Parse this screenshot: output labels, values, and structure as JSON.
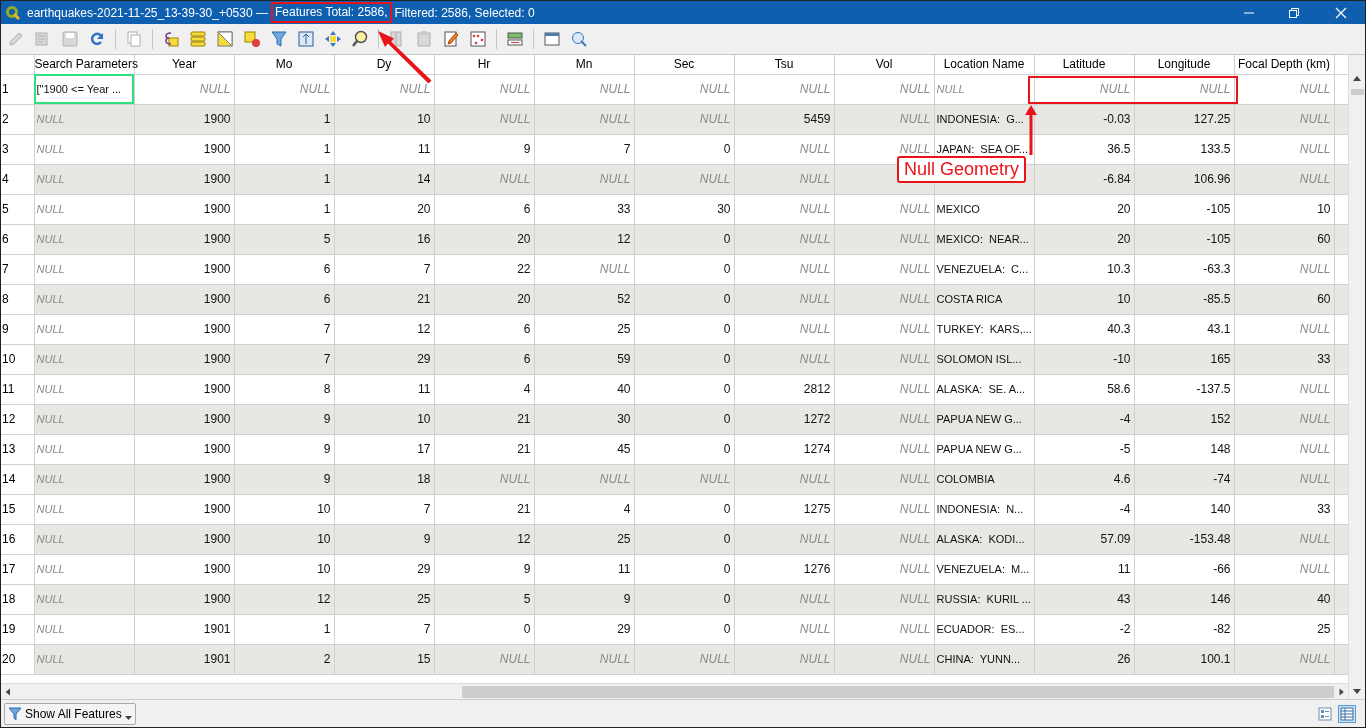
{
  "window": {
    "title_parts": [
      {
        "text": "earthquakes-2021-11-25_13-39-30_+0530 —",
        "highlighted": false
      },
      {
        "text": "Features Total: 2586,",
        "highlighted": true
      },
      {
        "text": "Filtered: 2586, Selected: 0",
        "highlighted": false
      }
    ]
  },
  "toolbar": [
    {
      "kind": "pencil",
      "disabled": true
    },
    {
      "kind": "multi-edit",
      "disabled": true
    },
    {
      "kind": "save",
      "disabled": true
    },
    {
      "kind": "refresh",
      "disabled": false
    },
    {
      "kind": "sep"
    },
    {
      "kind": "copy",
      "disabled": true
    },
    {
      "kind": "sep"
    },
    {
      "kind": "expression",
      "disabled": false
    },
    {
      "kind": "select-all",
      "disabled": false
    },
    {
      "kind": "invert",
      "disabled": false
    },
    {
      "kind": "deselect",
      "disabled": false
    },
    {
      "kind": "filter",
      "disabled": false
    },
    {
      "kind": "move-top",
      "disabled": false
    },
    {
      "kind": "pan",
      "disabled": false
    },
    {
      "kind": "zoom",
      "disabled": false
    },
    {
      "kind": "sep"
    },
    {
      "kind": "delete-field",
      "disabled": true
    },
    {
      "kind": "paste",
      "disabled": true
    },
    {
      "kind": "field-calc",
      "disabled": false
    },
    {
      "kind": "abacus",
      "disabled": false
    },
    {
      "kind": "sep"
    },
    {
      "kind": "conditional",
      "disabled": false
    },
    {
      "kind": "sep"
    },
    {
      "kind": "dock",
      "disabled": false
    },
    {
      "kind": "actions",
      "disabled": false
    }
  ],
  "table": {
    "columns": [
      {
        "label": "Search Parameters",
        "kind": "text"
      },
      {
        "label": "Year",
        "kind": "number"
      },
      {
        "label": "Mo",
        "kind": "number"
      },
      {
        "label": "Dy",
        "kind": "number"
      },
      {
        "label": "Hr",
        "kind": "number"
      },
      {
        "label": "Mn",
        "kind": "number"
      },
      {
        "label": "Sec",
        "kind": "number"
      },
      {
        "label": "Tsu",
        "kind": "number"
      },
      {
        "label": "Vol",
        "kind": "number"
      },
      {
        "label": "Location Name",
        "kind": "text"
      },
      {
        "label": "Latitude",
        "kind": "number"
      },
      {
        "label": "Longitude",
        "kind": "number"
      },
      {
        "label": "Focal Depth (km)",
        "kind": "number"
      }
    ],
    "rows": [
      {
        "num": "1",
        "focused": true,
        "cells": [
          {
            "v": "[\"1900 <= Year ...",
            "null": false
          },
          {
            "v": "NULL",
            "null": true
          },
          {
            "v": "NULL",
            "null": true
          },
          {
            "v": "NULL",
            "null": true
          },
          {
            "v": "NULL",
            "null": true
          },
          {
            "v": "NULL",
            "null": true
          },
          {
            "v": "NULL",
            "null": true
          },
          {
            "v": "NULL",
            "null": true
          },
          {
            "v": "NULL",
            "null": true
          },
          {
            "v": "NULL",
            "null": true
          },
          {
            "v": "NULL",
            "null": true
          },
          {
            "v": "NULL",
            "null": true
          },
          {
            "v": "NULL",
            "null": true
          }
        ]
      },
      {
        "num": "2",
        "focused": false,
        "cells": [
          {
            "v": "NULL",
            "null": true
          },
          {
            "v": "1900",
            "null": false
          },
          {
            "v": "1",
            "null": false
          },
          {
            "v": "10",
            "null": false
          },
          {
            "v": "NULL",
            "null": true
          },
          {
            "v": "NULL",
            "null": true
          },
          {
            "v": "NULL",
            "null": true
          },
          {
            "v": "5459",
            "null": false
          },
          {
            "v": "NULL",
            "null": true
          },
          {
            "v": "INDONESIA:  G...",
            "null": false
          },
          {
            "v": "-0.03",
            "null": false
          },
          {
            "v": "127.25",
            "null": false
          },
          {
            "v": "NULL",
            "null": true
          }
        ]
      },
      {
        "num": "3",
        "focused": false,
        "cells": [
          {
            "v": "NULL",
            "null": true
          },
          {
            "v": "1900",
            "null": false
          },
          {
            "v": "1",
            "null": false
          },
          {
            "v": "11",
            "null": false
          },
          {
            "v": "9",
            "null": false
          },
          {
            "v": "7",
            "null": false
          },
          {
            "v": "0",
            "null": false
          },
          {
            "v": "NULL",
            "null": true
          },
          {
            "v": "NULL",
            "null": true
          },
          {
            "v": "JAPAN:  SEA OF...",
            "null": false
          },
          {
            "v": "36.5",
            "null": false
          },
          {
            "v": "133.5",
            "null": false
          },
          {
            "v": "NULL",
            "null": true
          }
        ]
      },
      {
        "num": "4",
        "focused": false,
        "cells": [
          {
            "v": "NULL",
            "null": true
          },
          {
            "v": "1900",
            "null": false
          },
          {
            "v": "1",
            "null": false
          },
          {
            "v": "14",
            "null": false
          },
          {
            "v": "NULL",
            "null": true
          },
          {
            "v": "NULL",
            "null": true
          },
          {
            "v": "NULL",
            "null": true
          },
          {
            "v": "NULL",
            "null": true
          },
          null,
          null,
          {
            "v": "-6.84",
            "null": false
          },
          {
            "v": "106.96",
            "null": false
          },
          {
            "v": "NULL",
            "null": true
          }
        ]
      },
      {
        "num": "5",
        "focused": false,
        "cells": [
          {
            "v": "NULL",
            "null": true
          },
          {
            "v": "1900",
            "null": false
          },
          {
            "v": "1",
            "null": false
          },
          {
            "v": "20",
            "null": false
          },
          {
            "v": "6",
            "null": false
          },
          {
            "v": "33",
            "null": false
          },
          {
            "v": "30",
            "null": false
          },
          {
            "v": "NULL",
            "null": true
          },
          {
            "v": "NULL",
            "null": true
          },
          {
            "v": "MEXICO",
            "null": false
          },
          {
            "v": "20",
            "null": false
          },
          {
            "v": "-105",
            "null": false
          },
          {
            "v": "10",
            "null": false
          }
        ]
      },
      {
        "num": "6",
        "focused": false,
        "cells": [
          {
            "v": "NULL",
            "null": true
          },
          {
            "v": "1900",
            "null": false
          },
          {
            "v": "5",
            "null": false
          },
          {
            "v": "16",
            "null": false
          },
          {
            "v": "20",
            "null": false
          },
          {
            "v": "12",
            "null": false
          },
          {
            "v": "0",
            "null": false
          },
          {
            "v": "NULL",
            "null": true
          },
          {
            "v": "NULL",
            "null": true
          },
          {
            "v": "MEXICO:  NEAR...",
            "null": false
          },
          {
            "v": "20",
            "null": false
          },
          {
            "v": "-105",
            "null": false
          },
          {
            "v": "60",
            "null": false
          }
        ]
      },
      {
        "num": "7",
        "focused": false,
        "cells": [
          {
            "v": "NULL",
            "null": true
          },
          {
            "v": "1900",
            "null": false
          },
          {
            "v": "6",
            "null": false
          },
          {
            "v": "7",
            "null": false
          },
          {
            "v": "22",
            "null": false
          },
          {
            "v": "NULL",
            "null": true
          },
          {
            "v": "0",
            "null": false
          },
          {
            "v": "NULL",
            "null": true
          },
          {
            "v": "NULL",
            "null": true
          },
          {
            "v": "VENEZUELA:  C...",
            "null": false
          },
          {
            "v": "10.3",
            "null": false
          },
          {
            "v": "-63.3",
            "null": false
          },
          {
            "v": "NULL",
            "null": true
          }
        ]
      },
      {
        "num": "8",
        "focused": false,
        "cells": [
          {
            "v": "NULL",
            "null": true
          },
          {
            "v": "1900",
            "null": false
          },
          {
            "v": "6",
            "null": false
          },
          {
            "v": "21",
            "null": false
          },
          {
            "v": "20",
            "null": false
          },
          {
            "v": "52",
            "null": false
          },
          {
            "v": "0",
            "null": false
          },
          {
            "v": "NULL",
            "null": true
          },
          {
            "v": "NULL",
            "null": true
          },
          {
            "v": "COSTA RICA",
            "null": false
          },
          {
            "v": "10",
            "null": false
          },
          {
            "v": "-85.5",
            "null": false
          },
          {
            "v": "60",
            "null": false
          }
        ]
      },
      {
        "num": "9",
        "focused": false,
        "cells": [
          {
            "v": "NULL",
            "null": true
          },
          {
            "v": "1900",
            "null": false
          },
          {
            "v": "7",
            "null": false
          },
          {
            "v": "12",
            "null": false
          },
          {
            "v": "6",
            "null": false
          },
          {
            "v": "25",
            "null": false
          },
          {
            "v": "0",
            "null": false
          },
          {
            "v": "NULL",
            "null": true
          },
          {
            "v": "NULL",
            "null": true
          },
          {
            "v": "TURKEY:  KARS,...",
            "null": false
          },
          {
            "v": "40.3",
            "null": false
          },
          {
            "v": "43.1",
            "null": false
          },
          {
            "v": "NULL",
            "null": true
          }
        ]
      },
      {
        "num": "10",
        "focused": false,
        "cells": [
          {
            "v": "NULL",
            "null": true
          },
          {
            "v": "1900",
            "null": false
          },
          {
            "v": "7",
            "null": false
          },
          {
            "v": "29",
            "null": false
          },
          {
            "v": "6",
            "null": false
          },
          {
            "v": "59",
            "null": false
          },
          {
            "v": "0",
            "null": false
          },
          {
            "v": "NULL",
            "null": true
          },
          {
            "v": "NULL",
            "null": true
          },
          {
            "v": "SOLOMON ISL...",
            "null": false
          },
          {
            "v": "-10",
            "null": false
          },
          {
            "v": "165",
            "null": false
          },
          {
            "v": "33",
            "null": false
          }
        ]
      },
      {
        "num": "11",
        "focused": false,
        "cells": [
          {
            "v": "NULL",
            "null": true
          },
          {
            "v": "1900",
            "null": false
          },
          {
            "v": "8",
            "null": false
          },
          {
            "v": "11",
            "null": false
          },
          {
            "v": "4",
            "null": false
          },
          {
            "v": "40",
            "null": false
          },
          {
            "v": "0",
            "null": false
          },
          {
            "v": "2812",
            "null": false
          },
          {
            "v": "NULL",
            "null": true
          },
          {
            "v": "ALASKA:  SE. A...",
            "null": false
          },
          {
            "v": "58.6",
            "null": false
          },
          {
            "v": "-137.5",
            "null": false
          },
          {
            "v": "NULL",
            "null": true
          }
        ]
      },
      {
        "num": "12",
        "focused": false,
        "cells": [
          {
            "v": "NULL",
            "null": true
          },
          {
            "v": "1900",
            "null": false
          },
          {
            "v": "9",
            "null": false
          },
          {
            "v": "10",
            "null": false
          },
          {
            "v": "21",
            "null": false
          },
          {
            "v": "30",
            "null": false
          },
          {
            "v": "0",
            "null": false
          },
          {
            "v": "1272",
            "null": false
          },
          {
            "v": "NULL",
            "null": true
          },
          {
            "v": "PAPUA NEW G...",
            "null": false
          },
          {
            "v": "-4",
            "null": false
          },
          {
            "v": "152",
            "null": false
          },
          {
            "v": "NULL",
            "null": true
          }
        ]
      },
      {
        "num": "13",
        "focused": false,
        "cells": [
          {
            "v": "NULL",
            "null": true
          },
          {
            "v": "1900",
            "null": false
          },
          {
            "v": "9",
            "null": false
          },
          {
            "v": "17",
            "null": false
          },
          {
            "v": "21",
            "null": false
          },
          {
            "v": "45",
            "null": false
          },
          {
            "v": "0",
            "null": false
          },
          {
            "v": "1274",
            "null": false
          },
          {
            "v": "NULL",
            "null": true
          },
          {
            "v": "PAPUA NEW G...",
            "null": false
          },
          {
            "v": "-5",
            "null": false
          },
          {
            "v": "148",
            "null": false
          },
          {
            "v": "NULL",
            "null": true
          }
        ]
      },
      {
        "num": "14",
        "focused": false,
        "cells": [
          {
            "v": "NULL",
            "null": true
          },
          {
            "v": "1900",
            "null": false
          },
          {
            "v": "9",
            "null": false
          },
          {
            "v": "18",
            "null": false
          },
          {
            "v": "NULL",
            "null": true
          },
          {
            "v": "NULL",
            "null": true
          },
          {
            "v": "NULL",
            "null": true
          },
          {
            "v": "NULL",
            "null": true
          },
          {
            "v": "NULL",
            "null": true
          },
          {
            "v": "COLOMBIA",
            "null": false
          },
          {
            "v": "4.6",
            "null": false
          },
          {
            "v": "-74",
            "null": false
          },
          {
            "v": "NULL",
            "null": true
          }
        ]
      },
      {
        "num": "15",
        "focused": false,
        "cells": [
          {
            "v": "NULL",
            "null": true
          },
          {
            "v": "1900",
            "null": false
          },
          {
            "v": "10",
            "null": false
          },
          {
            "v": "7",
            "null": false
          },
          {
            "v": "21",
            "null": false
          },
          {
            "v": "4",
            "null": false
          },
          {
            "v": "0",
            "null": false
          },
          {
            "v": "1275",
            "null": false
          },
          {
            "v": "NULL",
            "null": true
          },
          {
            "v": "INDONESIA:  N...",
            "null": false
          },
          {
            "v": "-4",
            "null": false
          },
          {
            "v": "140",
            "null": false
          },
          {
            "v": "33",
            "null": false
          }
        ]
      },
      {
        "num": "16",
        "focused": false,
        "cells": [
          {
            "v": "NULL",
            "null": true
          },
          {
            "v": "1900",
            "null": false
          },
          {
            "v": "10",
            "null": false
          },
          {
            "v": "9",
            "null": false
          },
          {
            "v": "12",
            "null": false
          },
          {
            "v": "25",
            "null": false
          },
          {
            "v": "0",
            "null": false
          },
          {
            "v": "NULL",
            "null": true
          },
          {
            "v": "NULL",
            "null": true
          },
          {
            "v": "ALASKA:  KODI...",
            "null": false
          },
          {
            "v": "57.09",
            "null": false
          },
          {
            "v": "-153.48",
            "null": false
          },
          {
            "v": "NULL",
            "null": true
          }
        ]
      },
      {
        "num": "17",
        "focused": false,
        "cells": [
          {
            "v": "NULL",
            "null": true
          },
          {
            "v": "1900",
            "null": false
          },
          {
            "v": "10",
            "null": false
          },
          {
            "v": "29",
            "null": false
          },
          {
            "v": "9",
            "null": false
          },
          {
            "v": "11",
            "null": false
          },
          {
            "v": "0",
            "null": false
          },
          {
            "v": "1276",
            "null": false
          },
          {
            "v": "NULL",
            "null": true
          },
          {
            "v": "VENEZUELA:  M...",
            "null": false
          },
          {
            "v": "11",
            "null": false
          },
          {
            "v": "-66",
            "null": false
          },
          {
            "v": "NULL",
            "null": true
          }
        ]
      },
      {
        "num": "18",
        "focused": false,
        "cells": [
          {
            "v": "NULL",
            "null": true
          },
          {
            "v": "1900",
            "null": false
          },
          {
            "v": "12",
            "null": false
          },
          {
            "v": "25",
            "null": false
          },
          {
            "v": "5",
            "null": false
          },
          {
            "v": "9",
            "null": false
          },
          {
            "v": "0",
            "null": false
          },
          {
            "v": "NULL",
            "null": true
          },
          {
            "v": "NULL",
            "null": true
          },
          {
            "v": "RUSSIA:  KURIL ...",
            "null": false
          },
          {
            "v": "43",
            "null": false
          },
          {
            "v": "146",
            "null": false
          },
          {
            "v": "40",
            "null": false
          }
        ]
      },
      {
        "num": "19",
        "focused": false,
        "cells": [
          {
            "v": "NULL",
            "null": true
          },
          {
            "v": "1901",
            "null": false
          },
          {
            "v": "1",
            "null": false
          },
          {
            "v": "7",
            "null": false
          },
          {
            "v": "0",
            "null": false
          },
          {
            "v": "29",
            "null": false
          },
          {
            "v": "0",
            "null": false
          },
          {
            "v": "NULL",
            "null": true
          },
          {
            "v": "NULL",
            "null": true
          },
          {
            "v": "ECUADOR:  ES...",
            "null": false
          },
          {
            "v": "-2",
            "null": false
          },
          {
            "v": "-82",
            "null": false
          },
          {
            "v": "25",
            "null": false
          }
        ]
      },
      {
        "num": "20",
        "focused": false,
        "cells": [
          {
            "v": "NULL",
            "null": true
          },
          {
            "v": "1901",
            "null": false
          },
          {
            "v": "2",
            "null": false
          },
          {
            "v": "15",
            "null": false
          },
          {
            "v": "NULL",
            "null": true
          },
          {
            "v": "NULL",
            "null": true
          },
          {
            "v": "NULL",
            "null": true
          },
          {
            "v": "NULL",
            "null": true
          },
          {
            "v": "NULL",
            "null": true
          },
          {
            "v": "CHINA:  YUNN...",
            "null": false
          },
          {
            "v": "26",
            "null": false
          },
          {
            "v": "100.1",
            "null": false
          },
          {
            "v": "NULL",
            "null": true
          }
        ]
      }
    ]
  },
  "filter_button": {
    "label": "Show All Features"
  },
  "view_toggle": [
    {
      "kind": "form",
      "selected": false
    },
    {
      "kind": "table",
      "selected": true
    }
  ],
  "annotation": {
    "callout": "Null Geometry"
  }
}
